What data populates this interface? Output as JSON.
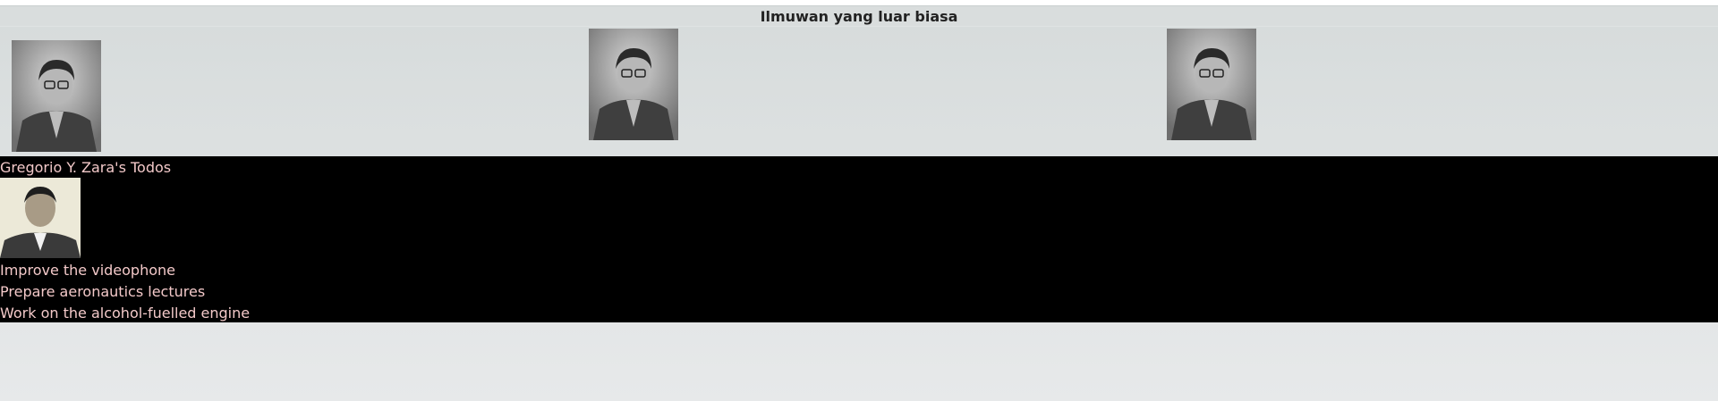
{
  "header": {
    "title": "Ilmuwan yang luar biasa"
  },
  "gallery": {
    "images": [
      {
        "icon": "portrait-photo"
      },
      {
        "icon": "portrait-photo"
      },
      {
        "icon": "portrait-photo"
      }
    ]
  },
  "todos": {
    "title": "Gregorio Y. Zara's Todos",
    "avatar_icon": "portrait-photo",
    "items": [
      "Improve the videophone",
      "Prepare aeronautics lectures",
      "Work on the alcohol-fuelled engine"
    ]
  },
  "colors": {
    "panel_background": "#000000",
    "todo_text": "#f3c9c9",
    "page_background": "#e3e6e7"
  }
}
